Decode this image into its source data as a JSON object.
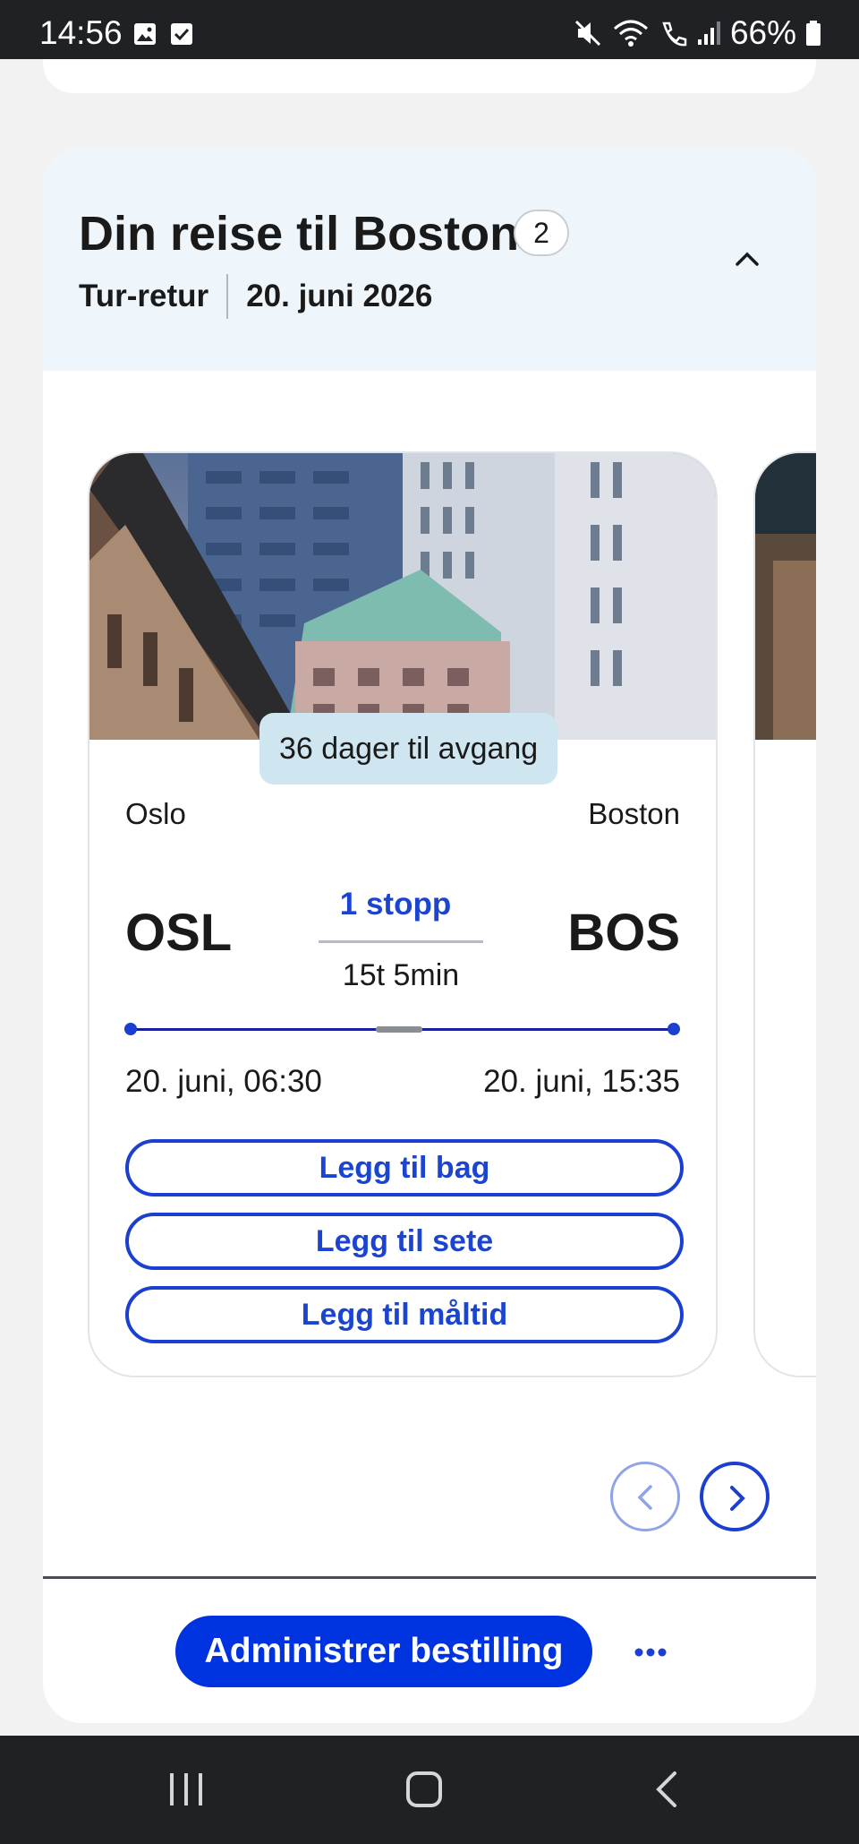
{
  "status_bar": {
    "time": "14:56",
    "battery": "66%",
    "icons": [
      "image-icon",
      "checkbox-icon",
      "mute-icon",
      "wifi-icon",
      "wifi-call-icon",
      "signal-icon",
      "battery-icon"
    ]
  },
  "trip": {
    "title": "Din reise til Boston",
    "count": "2",
    "type": "Tur-retur",
    "date": "20. juni 2026"
  },
  "flight": {
    "countdown": "36 dager til avgang",
    "origin_city": "Oslo",
    "destination_city": "Boston",
    "origin_code": "OSL",
    "destination_code": "BOS",
    "stops": "1 stopp",
    "duration": "15t 5min",
    "departure": "20. juni, 06:30",
    "arrival": "20. juni, 15:35"
  },
  "actions": {
    "bag": "Legg til bag",
    "seat": "Legg til sete",
    "meal": "Legg til måltid"
  },
  "footer": {
    "manage": "Administrer bestilling"
  },
  "colors": {
    "accent": "#1b3fd0",
    "primary_button": "#0033e0",
    "header_bg": "#eef6fb",
    "countdown_bg": "#cfe6f1"
  }
}
